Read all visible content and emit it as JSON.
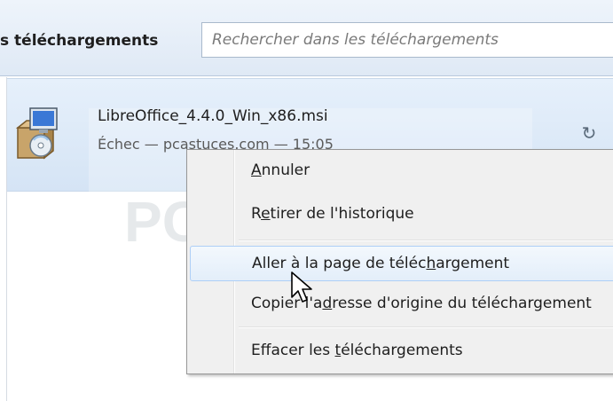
{
  "header": {
    "title": "s téléchargements",
    "search_placeholder": "Rechercher dans les téléchargements"
  },
  "download": {
    "filename": "LibreOffice_4.4.0_Win_x86.msi",
    "status": "Échec — pcastuces.com — 15:05",
    "icon": "installer-package-icon",
    "retry_icon": "retry-icon"
  },
  "context_menu": {
    "items": [
      {
        "mnemonic": "A",
        "rest": "nnuler"
      },
      {
        "pre": "R",
        "mnemonic": "e",
        "rest": "tirer de l'historique"
      },
      {
        "pre": "Aller à la page de téléc",
        "mnemonic": "h",
        "rest": "argement"
      },
      {
        "pre": "Copier l'a",
        "mnemonic": "d",
        "rest": "resse d'origine du téléchargement"
      },
      {
        "pre": "Effacer les ",
        "mnemonic": "t",
        "rest": "éléchargements"
      }
    ]
  },
  "watermark": {
    "text": "PCASTUCES"
  },
  "colors": {
    "hover_border": "#aecff7",
    "menu_bg": "#f0f0f0",
    "item_bg": "#dde9f6"
  }
}
